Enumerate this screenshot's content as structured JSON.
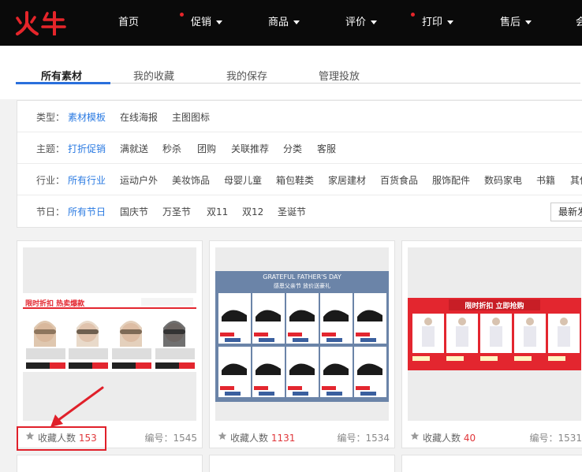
{
  "brand": {
    "logo_text": "火牛",
    "accent": "#e5252a"
  },
  "nav": [
    {
      "label": "首页",
      "dropdown": false,
      "dot": false
    },
    {
      "label": "促销",
      "dropdown": true,
      "dot": true
    },
    {
      "label": "商品",
      "dropdown": true,
      "dot": false
    },
    {
      "label": "评价",
      "dropdown": true,
      "dot": false
    },
    {
      "label": "打印",
      "dropdown": true,
      "dot": true
    },
    {
      "label": "售后",
      "dropdown": true,
      "dot": false
    },
    {
      "label": "会",
      "dropdown": false,
      "dot": false
    }
  ],
  "tabs": [
    {
      "label": "所有素材",
      "active": true
    },
    {
      "label": "我的收藏",
      "active": false
    },
    {
      "label": "我的保存",
      "active": false
    },
    {
      "label": "管理投放",
      "active": false
    }
  ],
  "filters": {
    "type": {
      "label": "类型：",
      "options": [
        "素材模板",
        "在线海报",
        "主图图标"
      ],
      "selected": 0
    },
    "theme": {
      "label": "主题：",
      "options": [
        "打折促销",
        "满就送",
        "秒杀",
        "团购",
        "关联推荐",
        "分类",
        "客服"
      ],
      "selected": 0
    },
    "industry": {
      "label": "行业：",
      "options": [
        "所有行业",
        "运动户外",
        "美妆饰品",
        "母婴儿童",
        "箱包鞋类",
        "家居建材",
        "百货食品",
        "服饰配件",
        "数码家电",
        "书籍",
        "其他"
      ],
      "selected": 0
    },
    "festival": {
      "label": "节日：",
      "options": [
        "所有节日",
        "国庆节",
        "万圣节",
        "双11",
        "双12",
        "圣诞节"
      ],
      "selected": 0
    }
  },
  "sort_button": {
    "label": "最新发布"
  },
  "cards": [
    {
      "fav_label": "收藏人数",
      "fav_count": "153",
      "serial": "编号：1545",
      "thumb": {
        "banner_title": "限时折扣  热卖爆款",
        "prices": [
          "¥1099",
          "¥1299",
          "¥1299",
          "¥1099"
        ],
        "buy": "立即购买"
      }
    },
    {
      "fav_label": "收藏人数",
      "fav_count": "1131",
      "serial": "编号：1534",
      "thumb": {
        "header_en": "GRATEFUL FATHER'S DAY",
        "header_cn": "感恩父亲节 放价送豪礼",
        "price": "¥351.00"
      }
    },
    {
      "fav_label": "收藏人数",
      "fav_count": "40",
      "serial": "编号：1531",
      "thumb": {
        "banner_title": "限时折扣  立即抢购",
        "price": "¥1024.00"
      }
    }
  ],
  "colors": {
    "link_blue": "#2a7ae2",
    "active_tab": "#2a6fdc",
    "count_red": "#e0373b",
    "highlight": "#e0202a"
  }
}
